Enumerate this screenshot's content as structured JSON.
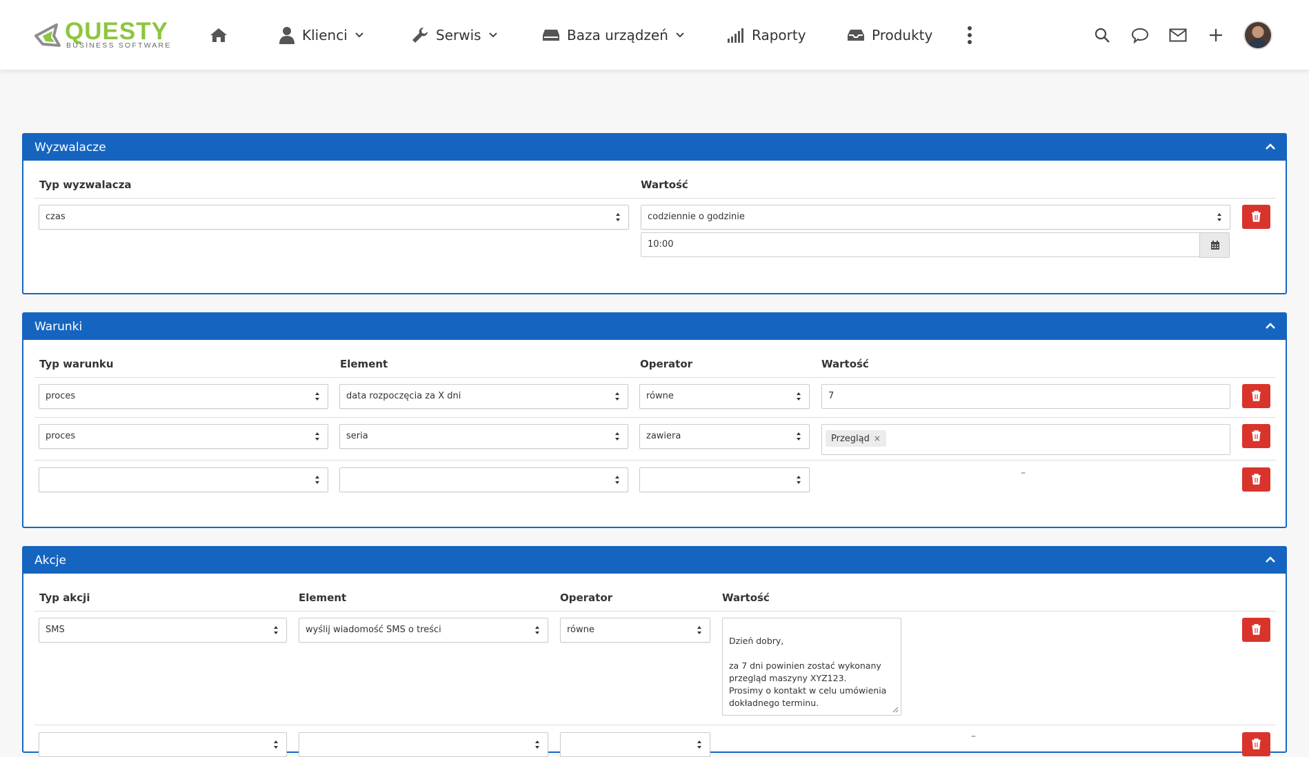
{
  "app": {
    "brand": "QUESTY",
    "tagline": "BUSINESS SOFTWARE"
  },
  "nav": {
    "items": [
      {
        "label": "Klienci",
        "icon": "user-icon",
        "dropdown": true
      },
      {
        "label": "Serwis",
        "icon": "wrench-icon",
        "dropdown": true
      },
      {
        "label": "Baza urządzeń",
        "icon": "device-icon",
        "dropdown": true
      },
      {
        "label": "Raporty",
        "icon": "chart-bars-icon",
        "dropdown": false
      },
      {
        "label": "Produkty",
        "icon": "inbox-icon",
        "dropdown": false
      }
    ],
    "right_icons": [
      "search-icon",
      "chat-icon",
      "mail-icon",
      "plus-icon",
      "avatar"
    ]
  },
  "triggers": {
    "title": "Wyzwalacze",
    "columns": [
      "Typ wyzwalacza",
      "Wartość"
    ],
    "row": {
      "type": "czas",
      "value": "codziennie o godzinie",
      "time": "10:00"
    }
  },
  "conditions": {
    "title": "Warunki",
    "columns": [
      "Typ warunku",
      "Element",
      "Operator",
      "Wartość"
    ],
    "rows": [
      {
        "type": "proces",
        "element": "data rozpoczęcia za X dni",
        "operator": "równe",
        "value": "7"
      },
      {
        "type": "proces",
        "element": "seria",
        "operator": "zawiera",
        "tag": "Przegląd"
      },
      {
        "type": "",
        "element": "",
        "operator": "",
        "value": "–"
      }
    ]
  },
  "actions": {
    "title": "Akcje",
    "columns": [
      "Typ akcji",
      "Element",
      "Operator",
      "Wartość"
    ],
    "rows": [
      {
        "type": "SMS",
        "element": "wyślij wiadomość SMS o treści",
        "operator": "równe",
        "message": "Dzień dobry,\n\nza 7 dni powinien zostać wykonany przegląd maszyny XYZ123.\nProsimy o kontakt w celu umówienia dokładnego terminu."
      },
      {
        "type": "",
        "element": "",
        "operator": "",
        "value": "–"
      }
    ]
  },
  "colors": {
    "primary": "#1565c0",
    "danger": "#d9342b",
    "brand_green": "#8cc63f"
  }
}
